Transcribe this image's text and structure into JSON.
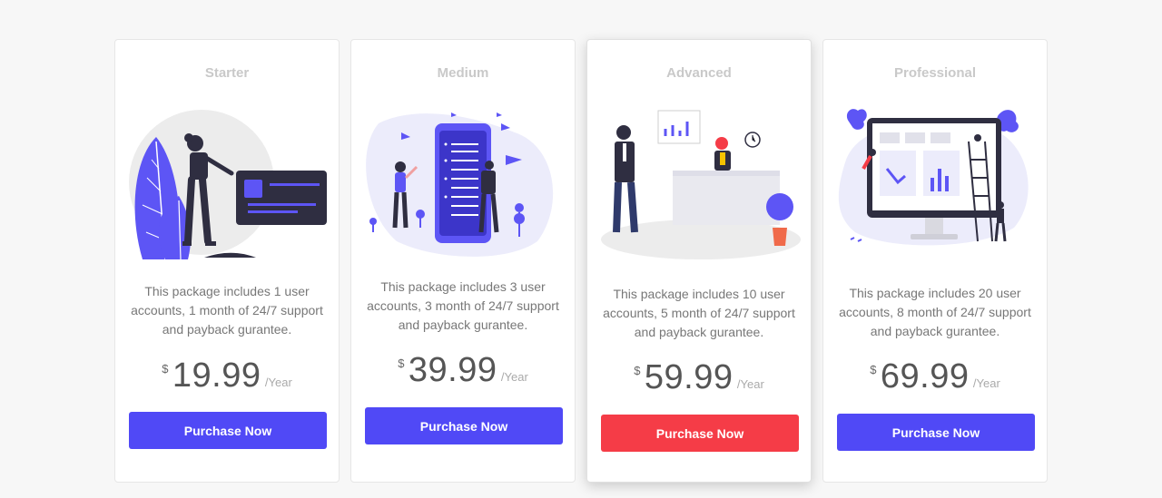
{
  "plans": [
    {
      "title": "Starter",
      "description": "This package includes 1 user accounts, 1 month of 24/7 support and payback gurantee.",
      "currency": "$",
      "price": "19.99",
      "period": "/Year",
      "button": "Purchase Now"
    },
    {
      "title": "Medium",
      "description": "This package includes 3 user accounts, 3 month of 24/7 support and payback gurantee.",
      "currency": "$",
      "price": "39.99",
      "period": "/Year",
      "button": "Purchase Now"
    },
    {
      "title": "Advanced",
      "description": "This package includes 10 user accounts, 5 month of 24/7 support and payback gurantee.",
      "currency": "$",
      "price": "59.99",
      "period": "/Year",
      "button": "Purchase Now"
    },
    {
      "title": "Professional",
      "description": "This package includes 20 user accounts, 8 month of 24/7 support and payback gurantee.",
      "currency": "$",
      "price": "69.99",
      "period": "/Year",
      "button": "Purchase Now"
    }
  ],
  "colors": {
    "primary": "#5049f6",
    "accent": "#f53c47",
    "illustration_purple": "#5d55f5",
    "illustration_dark": "#2f2e41"
  },
  "illustrations": [
    "woman-card-illustration",
    "phone-messages-illustration",
    "office-reception-illustration",
    "monitor-dashboard-illustration"
  ]
}
